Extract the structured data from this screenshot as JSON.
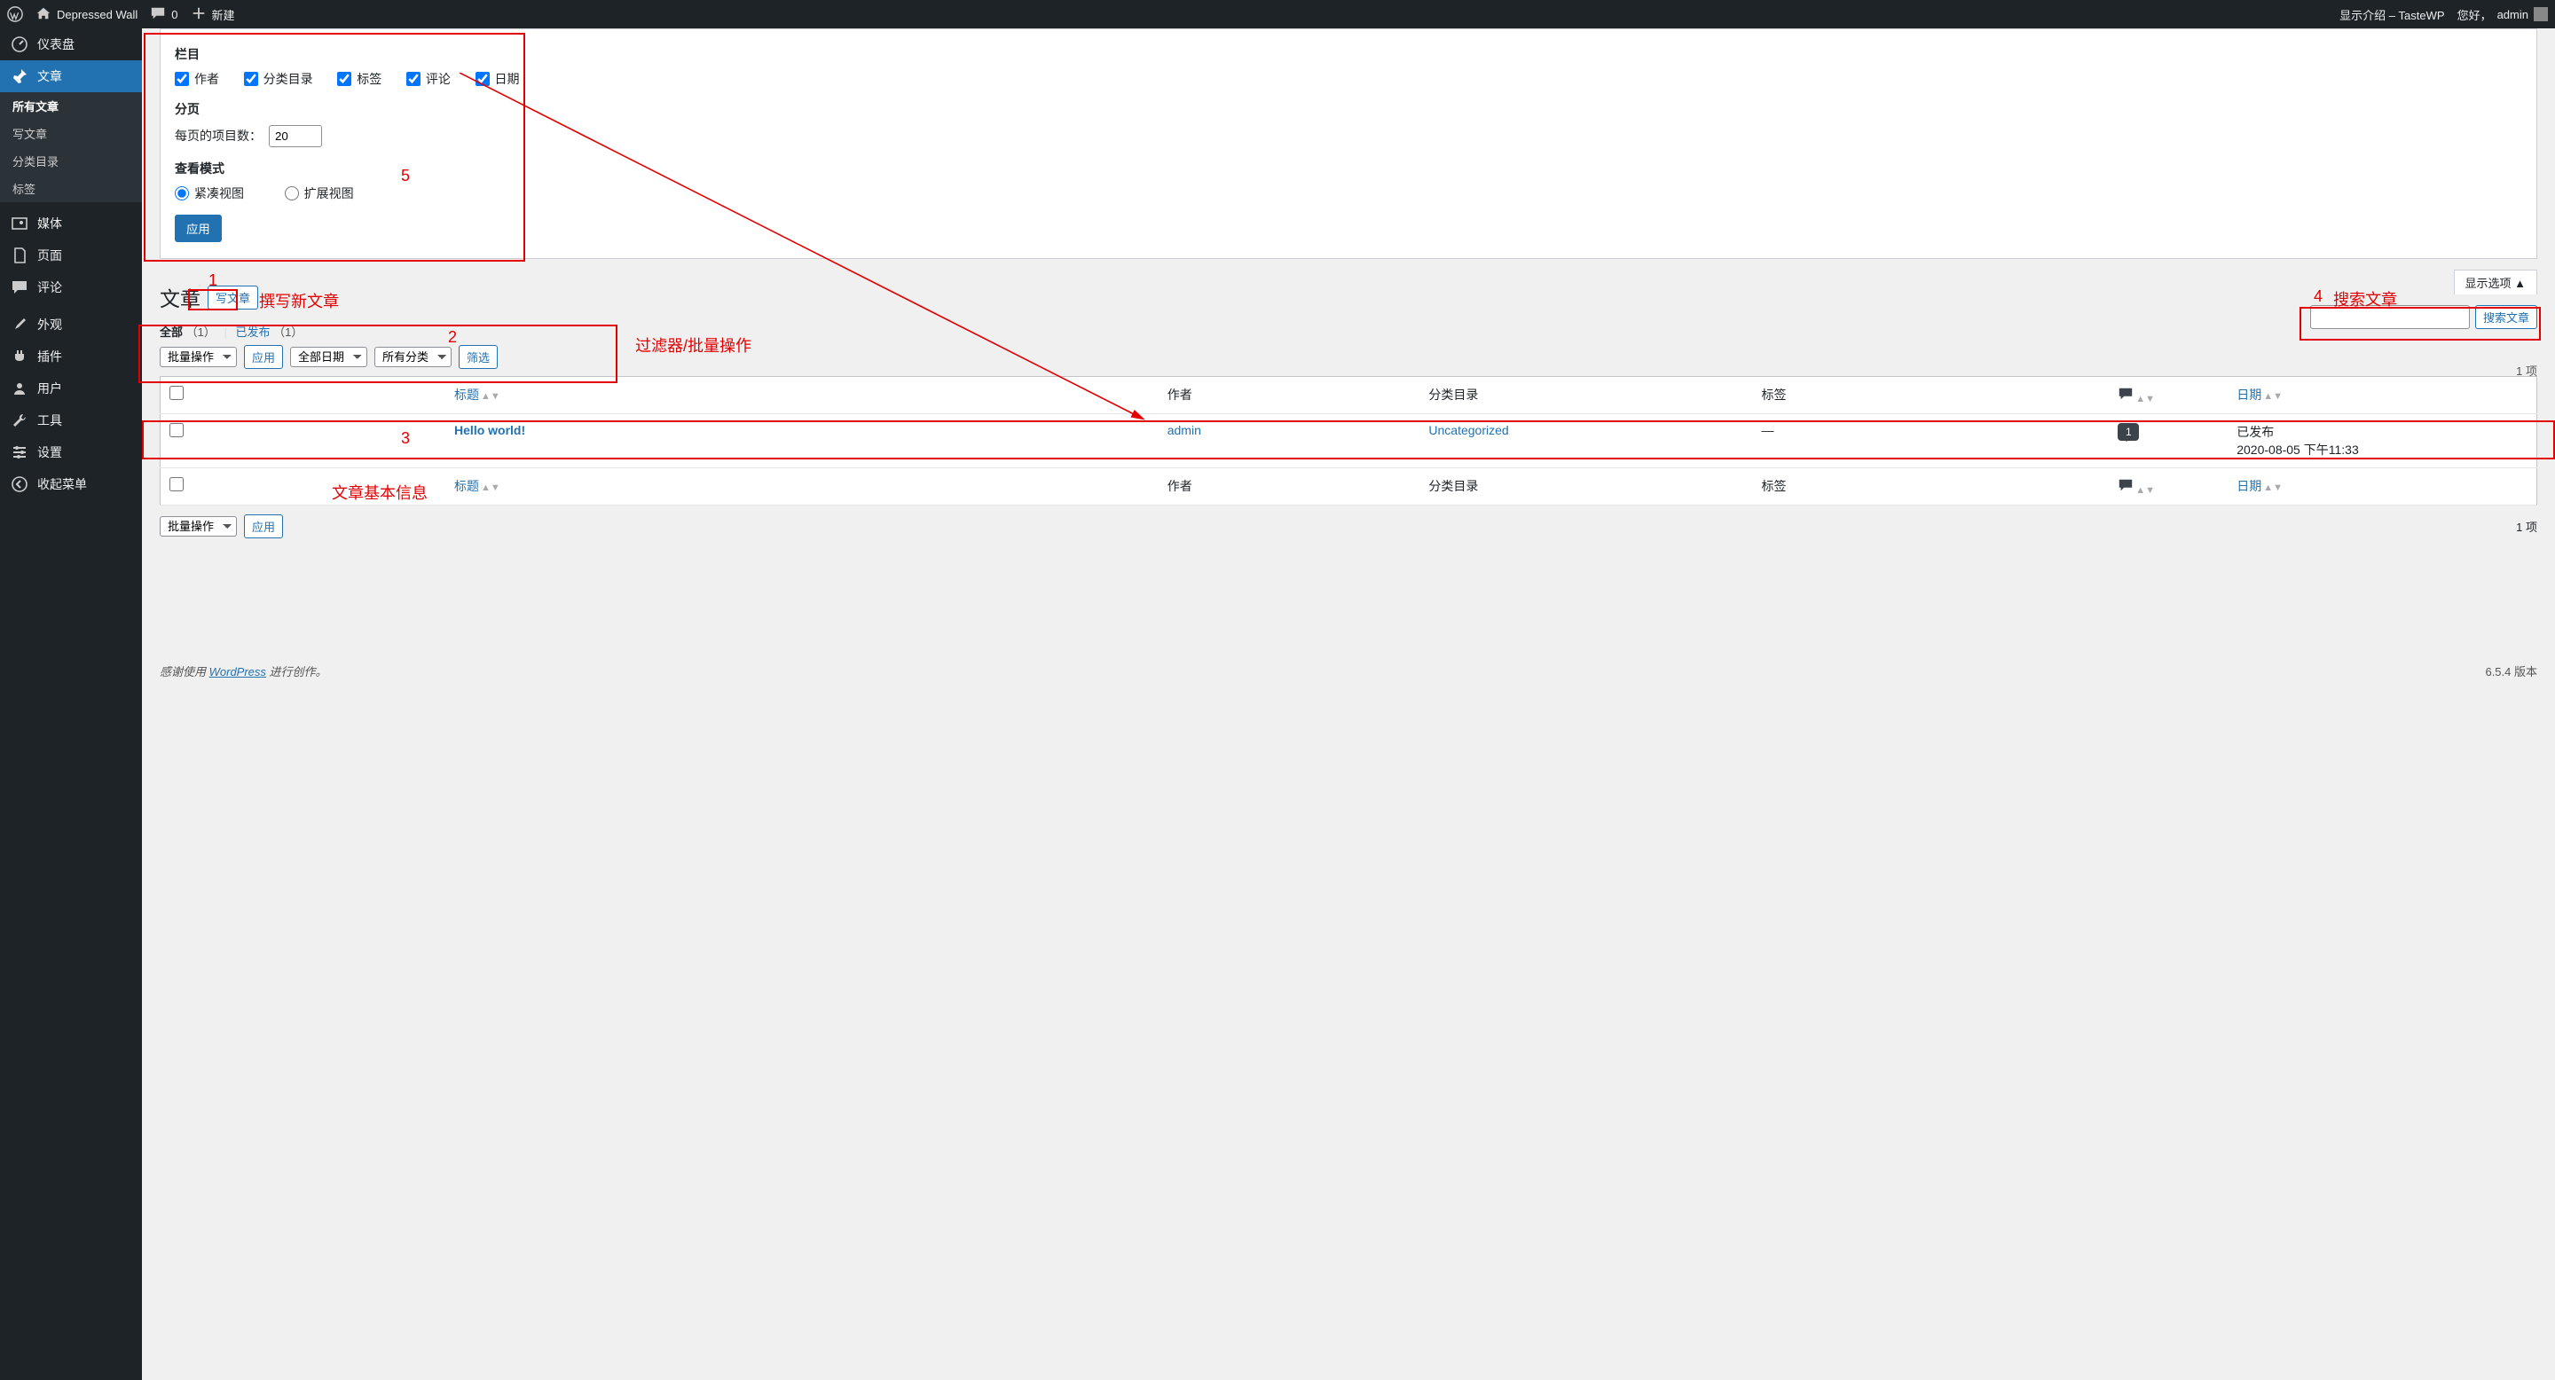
{
  "adminbar": {
    "site_name": "Depressed Wall",
    "comments_count": "0",
    "new_label": "新建",
    "promo": "显示介绍 – TasteWP",
    "greeting": "您好，",
    "user": "admin"
  },
  "sidebar": {
    "dashboard": "仪表盘",
    "posts": "文章",
    "posts_sub": {
      "all": "所有文章",
      "new": "写文章",
      "categories": "分类目录",
      "tags": "标签"
    },
    "media": "媒体",
    "pages": "页面",
    "comments": "评论",
    "appearance": "外观",
    "plugins": "插件",
    "users": "用户",
    "tools": "工具",
    "settings": "设置",
    "collapse": "收起菜单"
  },
  "screen_options": {
    "columns_legend": "栏目",
    "col_author": "作者",
    "col_categories": "分类目录",
    "col_tags": "标签",
    "col_comments": "评论",
    "col_date": "日期",
    "paging_legend": "分页",
    "per_page_label": "每页的项目数：",
    "per_page_value": "20",
    "view_legend": "查看模式",
    "view_compact": "紧凑视图",
    "view_extended": "扩展视图",
    "apply_btn": "应用",
    "tab_label": "显示选项 ▲"
  },
  "heading": {
    "title": "文章",
    "add_new": "写文章"
  },
  "subsubsub": {
    "all_label": "全部",
    "all_count": "（1）",
    "published_label": "已发布",
    "published_count": "（1）"
  },
  "filters": {
    "bulk": "批量操作",
    "apply": "应用",
    "all_dates": "全部日期",
    "all_cats": "所有分类",
    "filter_btn": "筛选"
  },
  "search": {
    "button": "搜索文章"
  },
  "count_label": "1 项",
  "table": {
    "th_title": "标题",
    "th_author": "作者",
    "th_categories": "分类目录",
    "th_tags": "标签",
    "th_date": "日期",
    "rows": [
      {
        "title": "Hello world!",
        "author": "admin",
        "categories": "Uncategorized",
        "tags": "—",
        "comments": "1",
        "status": "已发布",
        "date": "2020-08-05 下午11:33"
      }
    ]
  },
  "footer": {
    "thanks_pre": "感谢使用 ",
    "wp": "WordPress",
    "thanks_post": " 进行创作。",
    "version": "6.5.4 版本"
  },
  "annotations": {
    "n1": "1",
    "n2": "2",
    "n3": "3",
    "n4": "4",
    "n5": "5",
    "l1": "撰写新文章",
    "l2": "过滤器/批量操作",
    "l3": "文章基本信息",
    "l4": "搜索文章"
  }
}
